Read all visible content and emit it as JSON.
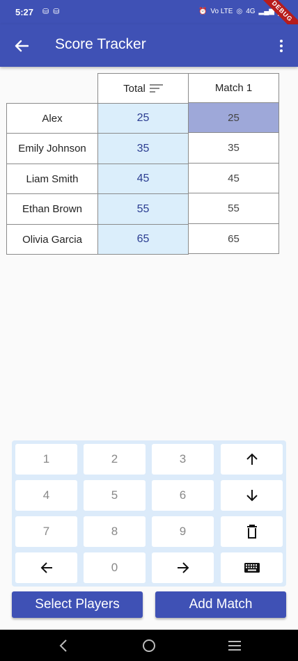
{
  "status_bar": {
    "time": "5:27",
    "left_icons": "⛁⛁",
    "right_icons": [
      "⏰",
      "Vo LTE",
      "◎",
      "4G",
      "▂▄▆"
    ],
    "debug_label": "DEBUG"
  },
  "app_bar": {
    "title": "Score Tracker"
  },
  "table": {
    "total_header": "Total",
    "match_headers": [
      "Match 1"
    ],
    "rows": [
      {
        "name": "Alex",
        "total": "25",
        "matches": [
          "25"
        ]
      },
      {
        "name": "Emily Johnson",
        "total": "35",
        "matches": [
          "35"
        ]
      },
      {
        "name": "Liam Smith",
        "total": "45",
        "matches": [
          "45"
        ]
      },
      {
        "name": "Ethan Brown",
        "total": "55",
        "matches": [
          "55"
        ]
      },
      {
        "name": "Olivia Garcia",
        "total": "65",
        "matches": [
          "65"
        ]
      }
    ]
  },
  "keypad": {
    "keys": [
      "1",
      "2",
      "3",
      "4",
      "5",
      "6",
      "7",
      "8",
      "9",
      "0"
    ]
  },
  "buttons": {
    "select_players": "Select Players",
    "add_match": "Add Match"
  }
}
